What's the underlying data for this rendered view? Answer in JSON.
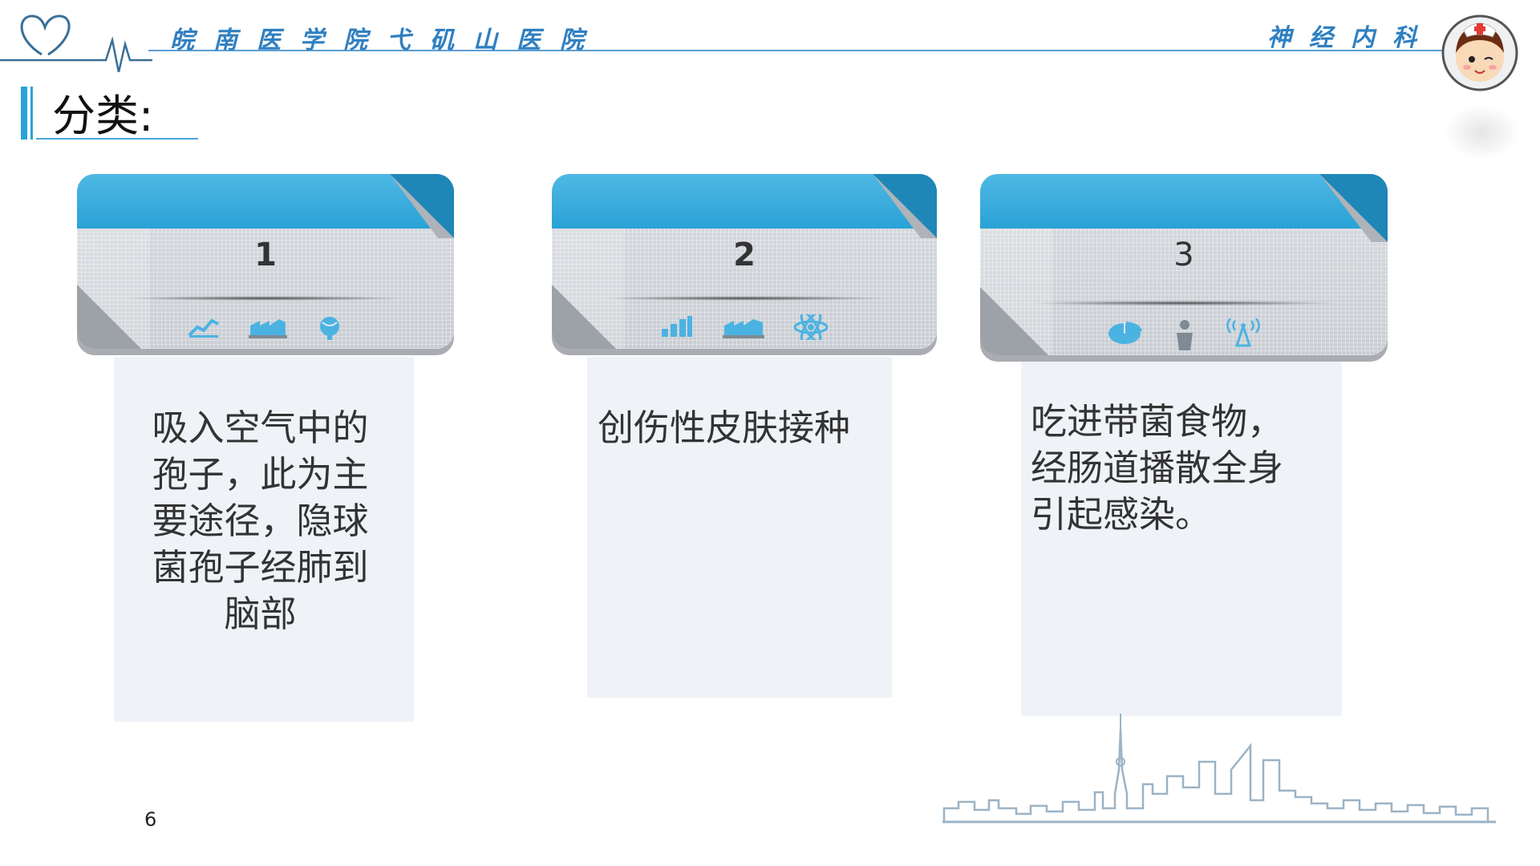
{
  "header": {
    "hospital_name": "皖南医学院弋矶山医院",
    "department": "神经内科"
  },
  "section": {
    "title": "分类:"
  },
  "cards": [
    {
      "number": "1",
      "text_lines": [
        "吸入空气中的",
        "孢子，此为主",
        "要途径，隐球",
        "菌孢子经肺到",
        "脑部"
      ],
      "icons": [
        "line-chart-icon",
        "factory-icon",
        "globe-icon"
      ]
    },
    {
      "number": "2",
      "text_lines": [
        "创伤性皮肤接种"
      ],
      "icons": [
        "bar-chart-icon",
        "factory-icon",
        "atom-icon"
      ]
    },
    {
      "number": "3",
      "text_lines": [
        "吃进带菌食物，",
        "经肠道播散全身",
        "引起感染。"
      ],
      "icons": [
        "pie-chart-icon",
        "person-icon",
        "signal-tower-icon"
      ]
    }
  ],
  "footer": {
    "page_number": "6"
  },
  "colors": {
    "accent": "#29a3d8",
    "header_text": "#2f7fc1",
    "panel": "#eff3f8"
  }
}
